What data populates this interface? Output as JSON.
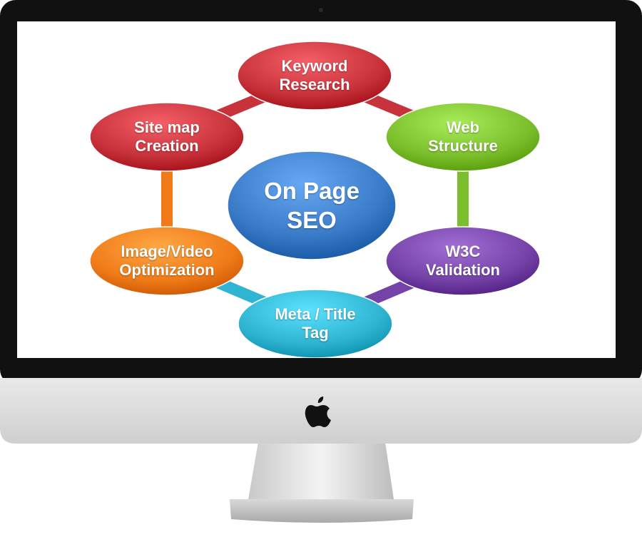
{
  "diagram": {
    "center": {
      "label": "On Page\nSEO",
      "color": "#3a7bc8"
    },
    "nodes": [
      {
        "id": "keyword-research",
        "label": "Keyword\nResearch",
        "color": "#c8323a"
      },
      {
        "id": "web-structure",
        "label": "Web\nStructure",
        "color": "#7cbf2d"
      },
      {
        "id": "w3c-validation",
        "label": "W3C\nValidation",
        "color": "#7543a8"
      },
      {
        "id": "meta-title-tag",
        "label": "Meta / Title\nTag",
        "color": "#2fb4d1"
      },
      {
        "id": "image-video-optimization",
        "label": "Image/Video\nOptimization",
        "color": "#f07b18"
      },
      {
        "id": "site-map-creation",
        "label": "Site map\nCreation",
        "color": "#c8323a"
      }
    ]
  },
  "device": {
    "logo_icon": "apple-logo-icon"
  }
}
